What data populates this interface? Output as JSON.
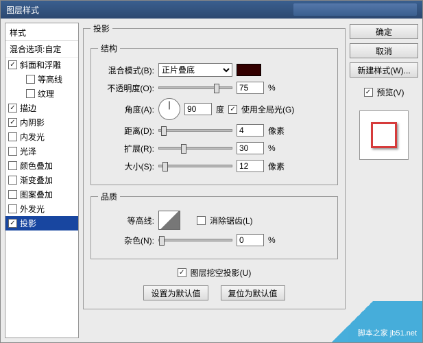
{
  "title": "图层样式",
  "styles": {
    "header": "样式",
    "blendOptions": "混合选项:自定",
    "items": [
      {
        "label": "斜面和浮雕",
        "checked": true,
        "indent": false
      },
      {
        "label": "等高线",
        "checked": false,
        "indent": true
      },
      {
        "label": "纹理",
        "checked": false,
        "indent": true
      },
      {
        "label": "描边",
        "checked": true,
        "indent": false
      },
      {
        "label": "内阴影",
        "checked": true,
        "indent": false
      },
      {
        "label": "内发光",
        "checked": false,
        "indent": false
      },
      {
        "label": "光泽",
        "checked": false,
        "indent": false
      },
      {
        "label": "颜色叠加",
        "checked": false,
        "indent": false
      },
      {
        "label": "渐变叠加",
        "checked": false,
        "indent": false
      },
      {
        "label": "图案叠加",
        "checked": false,
        "indent": false
      },
      {
        "label": "外发光",
        "checked": false,
        "indent": false
      },
      {
        "label": "投影",
        "checked": true,
        "indent": false,
        "selected": true
      }
    ]
  },
  "panel": {
    "title": "投影",
    "structure": {
      "title": "结构",
      "blendModeLabel": "混合模式(B):",
      "blendModeValue": "正片叠底",
      "colorHex": "#330000",
      "opacityLabel": "不透明度(O):",
      "opacityValue": "75",
      "angleLabel": "角度(A):",
      "angleValue": "90",
      "angleUnit": "度",
      "globalLightLabel": "使用全局光(G)",
      "globalLightChecked": true,
      "distanceLabel": "距离(D):",
      "distanceValue": "4",
      "spreadLabel": "扩展(R):",
      "spreadValue": "30",
      "sizeLabel": "大小(S):",
      "sizeValue": "12",
      "unitPercent": "%",
      "unitPixel": "像素"
    },
    "quality": {
      "title": "品质",
      "contourLabel": "等高线:",
      "antiAliasLabel": "消除锯齿(L)",
      "antiAliasChecked": false,
      "noiseLabel": "杂色(N):",
      "noiseValue": "0"
    },
    "knockoutLabel": "图层挖空投影(U)",
    "knockoutChecked": true,
    "setDefault": "设置为默认值",
    "resetDefault": "复位为默认值"
  },
  "buttons": {
    "ok": "确定",
    "cancel": "取消",
    "newStyle": "新建样式(W)...",
    "previewLabel": "预览(V)",
    "previewChecked": true
  },
  "watermark": "脚本之家 jb51.net"
}
